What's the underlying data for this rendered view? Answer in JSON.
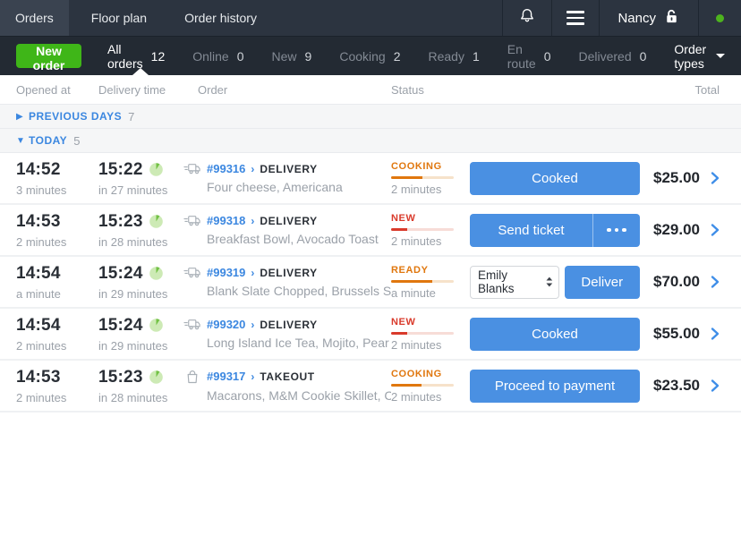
{
  "colors": {
    "accent_blue": "#4a90e2",
    "link_blue": "#3b87e0",
    "green": "#3fb618",
    "cooking_orange": "#e0770e",
    "new_red": "#d93a2b",
    "ready_orange": "#e0770e"
  },
  "navbar": {
    "tabs": [
      {
        "label": "Orders"
      },
      {
        "label": "Floor plan"
      },
      {
        "label": "Order history"
      }
    ],
    "user_name": "Nancy"
  },
  "filter_bar": {
    "new_order_label": "New order",
    "tabs": [
      {
        "label": "All orders",
        "count": "12"
      },
      {
        "label": "Online",
        "count": "0"
      },
      {
        "label": "New",
        "count": "9"
      },
      {
        "label": "Cooking",
        "count": "2"
      },
      {
        "label": "Ready",
        "count": "1"
      },
      {
        "label": "En route",
        "count": "0"
      },
      {
        "label": "Delivered",
        "count": "0"
      }
    ],
    "order_types_label": "Order types"
  },
  "table_headers": {
    "opened_at": "Opened at",
    "delivery_time": "Delivery time",
    "order": "Order",
    "status": "Status",
    "total": "Total"
  },
  "sections": [
    {
      "label": "PREVIOUS DAYS",
      "count": "7",
      "caret": "▶"
    },
    {
      "label": "TODAY",
      "count": "5",
      "caret": "▼"
    }
  ],
  "orders": [
    {
      "opened_time": "14:52",
      "opened_ago": "3 minutes",
      "delivery_time": "15:22",
      "delivery_in": "in 27 minutes",
      "number": "#99316",
      "number_caret": "›",
      "type": "DELIVERY",
      "type_icon": "truck-icon",
      "items": "Four cheese, Americana",
      "status": {
        "label": "COOKING",
        "sub": "2 minutes",
        "progress": 50,
        "color": "#e0770e",
        "track": "#f6e2ca"
      },
      "action": {
        "kind": "button",
        "label": "Cooked"
      },
      "total": "$25.00"
    },
    {
      "opened_time": "14:53",
      "opened_ago": "2 minutes",
      "delivery_time": "15:23",
      "delivery_in": "in 28 minutes",
      "number": "#99318",
      "number_caret": "›",
      "type": "DELIVERY",
      "type_icon": "truck-icon",
      "items": "Breakfast Bowl, Avocado Toast",
      "status": {
        "label": "NEW",
        "sub": "2 minutes",
        "progress": 25,
        "color": "#d93a2b",
        "track": "#f7dcd7"
      },
      "action": {
        "kind": "split-button",
        "label": "Send ticket"
      },
      "total": "$29.00"
    },
    {
      "opened_time": "14:54",
      "opened_ago": "a minute",
      "delivery_time": "15:24",
      "delivery_in": "in 29 minutes",
      "number": "#99319",
      "number_caret": "›",
      "type": "DELIVERY",
      "type_icon": "truck-icon",
      "items": "Blank Slate Chopped, Brussels Sp...",
      "status": {
        "label": "READY",
        "sub": "a minute",
        "progress": 65,
        "color": "#e0770e",
        "track": "#f6e2ca"
      },
      "action": {
        "kind": "select-and-button",
        "select_value": "Emily Blanks",
        "label": "Deliver"
      },
      "total": "$70.00"
    },
    {
      "opened_time": "14:54",
      "opened_ago": "2 minutes",
      "delivery_time": "15:24",
      "delivery_in": "in 29 minutes",
      "number": "#99320",
      "number_caret": "›",
      "type": "DELIVERY",
      "type_icon": "truck-icon",
      "items": "Long Island Ice Tea, Mojito, Pear C...",
      "status": {
        "label": "NEW",
        "sub": "2 minutes",
        "progress": 25,
        "color": "#d93a2b",
        "track": "#f7dcd7"
      },
      "action": {
        "kind": "button",
        "label": "Cooked"
      },
      "total": "$55.00"
    },
    {
      "opened_time": "14:53",
      "opened_ago": "2 minutes",
      "delivery_time": "15:23",
      "delivery_in": "in 28 minutes",
      "number": "#99317",
      "number_caret": "›",
      "type": "TAKEOUT",
      "type_icon": "bag-icon",
      "items": "Macarons, M&M Cookie Skillet, Co...",
      "status": {
        "label": "COOKING",
        "sub": "2 minutes",
        "progress": 48,
        "color": "#e0770e",
        "track": "#f6e2ca"
      },
      "action": {
        "kind": "button",
        "label": "Proceed to payment"
      },
      "total": "$23.50"
    }
  ]
}
